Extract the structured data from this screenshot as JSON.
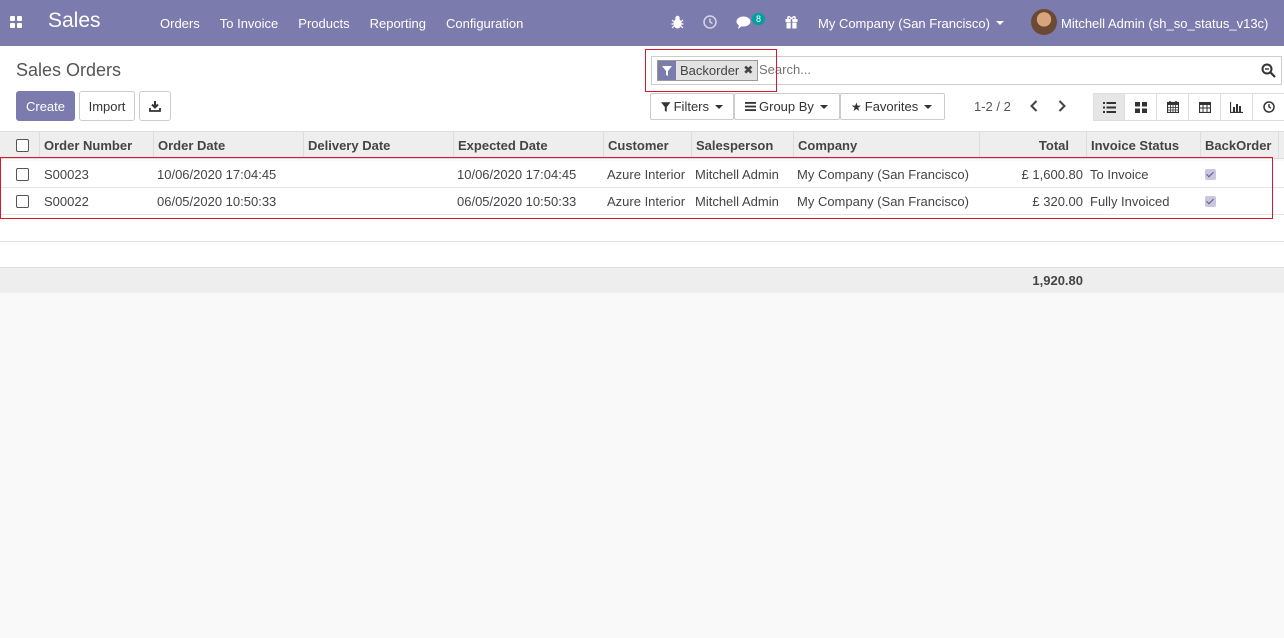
{
  "navbar": {
    "brand": "Sales",
    "menu": [
      "Orders",
      "To Invoice",
      "Products",
      "Reporting",
      "Configuration"
    ],
    "message_count": "8",
    "company": "My Company (San Francisco)",
    "user": "Mitchell Admin (sh_so_status_v13c)"
  },
  "page": {
    "title": "Sales Orders"
  },
  "buttons": {
    "create": "Create",
    "import": "Import"
  },
  "search": {
    "facet": "Backorder",
    "placeholder": "Search..."
  },
  "filters": {
    "filters": "Filters",
    "group_by": "Group By",
    "favorites": "Favorites"
  },
  "pager": "1-2 / 2",
  "table": {
    "columns": [
      "Order Number",
      "Order Date",
      "Delivery Date",
      "Expected Date",
      "Customer",
      "Salesperson",
      "Company",
      "Total",
      "Invoice Status",
      "BackOrder"
    ],
    "rows": [
      {
        "number": "S00023",
        "order_date": "10/06/2020 17:04:45",
        "delivery_date": "",
        "expected_date": "10/06/2020 17:04:45",
        "customer": "Azure Interior",
        "salesperson": "Mitchell Admin",
        "company": "My Company (San Francisco)",
        "total": "£ 1,600.80",
        "invoice_status": "To Invoice",
        "backorder": true
      },
      {
        "number": "S00022",
        "order_date": "06/05/2020 10:50:33",
        "delivery_date": "",
        "expected_date": "06/05/2020 10:50:33",
        "customer": "Azure Interior",
        "salesperson": "Mitchell Admin",
        "company": "My Company (San Francisco)",
        "total": "£ 320.00",
        "invoice_status": "Fully Invoiced",
        "backorder": true
      }
    ],
    "footer_total": "1,920.80"
  },
  "colors": {
    "primary": "#7c7bad",
    "highlight": "#d9182d",
    "badge": "#00a09d"
  }
}
